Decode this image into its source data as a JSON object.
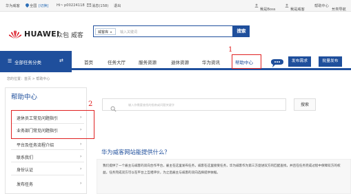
{
  "topbar": {
    "site": "华为威客",
    "location": "全国",
    "switch": "[切换]",
    "greeting": "Hi~",
    "user_id": "p00224118",
    "messages": "消息(158)",
    "logout": "退出",
    "i_am_boss": "我是Boss",
    "i_am_weike": "我是威客",
    "help_center": "帮助中心",
    "category_nav": "分类导航"
  },
  "header": {
    "logo_text": "HUAWEI",
    "logo_sub": "众包 威客",
    "search_category": "威客库",
    "search_placeholder": "输入关键词",
    "search_button": "搜索"
  },
  "nav": {
    "all_tasks": "全部任务分类",
    "items": [
      "首页",
      "任务大厅",
      "服务资源",
      "退休资源",
      "华为资讯",
      "帮助中心"
    ],
    "publish_demand": "发布需求",
    "batch_publish": "批量发布",
    "annotation_1": "1"
  },
  "breadcrumb": "您的位置：首页 > 帮助中心",
  "sidebar": {
    "title": "帮助中心",
    "annotation_2": "2",
    "items": [
      "退休员工常见问题指引",
      "业务部门常见问题指引",
      "平台及任务流程介绍",
      "联系我们",
      "身份认证",
      "发布任务"
    ]
  },
  "main": {
    "search_placeholder": "输入你需要查找的指南或问题关键字",
    "search_button": "搜索",
    "question_title": "华为威客网站能提供什么？",
    "answer": "我们提供了一个雇主与威客的双向合作平台，雇主在这里发布任务，威客在这里接受任务，华为威客作为第三方促进双方的匹配查找，并且在任务完成过程中保障双方的权益。任务完成双方可以在平台上互相评价，为之后雇主与威客的双向选择提供依据。"
  },
  "colors": {
    "brand_blue": "#1f4f9c",
    "annotation_red": "#e02020",
    "huawei_red": "#d7000f"
  }
}
